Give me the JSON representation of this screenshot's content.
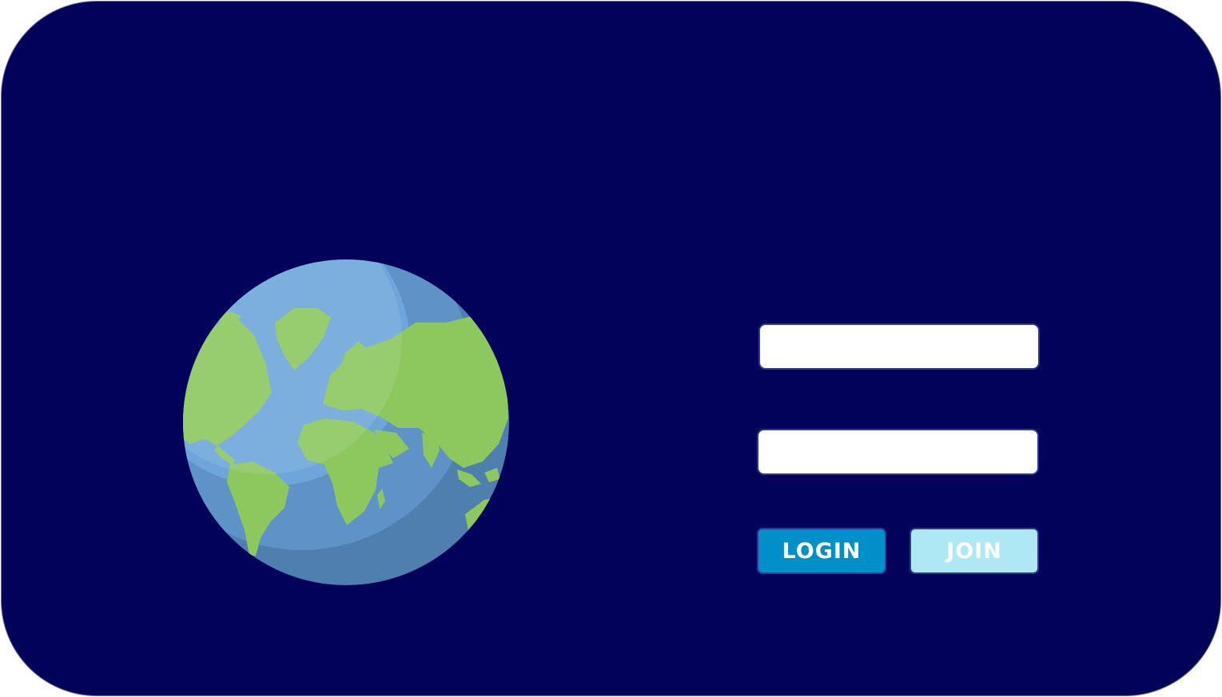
{
  "colors": {
    "background": "#02025a",
    "login_button": "#0090c9",
    "join_button": "#ade8f4",
    "ocean": "#5a8fc9",
    "land": "#8cc85e"
  },
  "globe": {
    "icon": "globe-icon"
  },
  "form": {
    "username_value": "",
    "password_value": "",
    "login_label": "LOGIN",
    "join_label": "JOIN"
  }
}
